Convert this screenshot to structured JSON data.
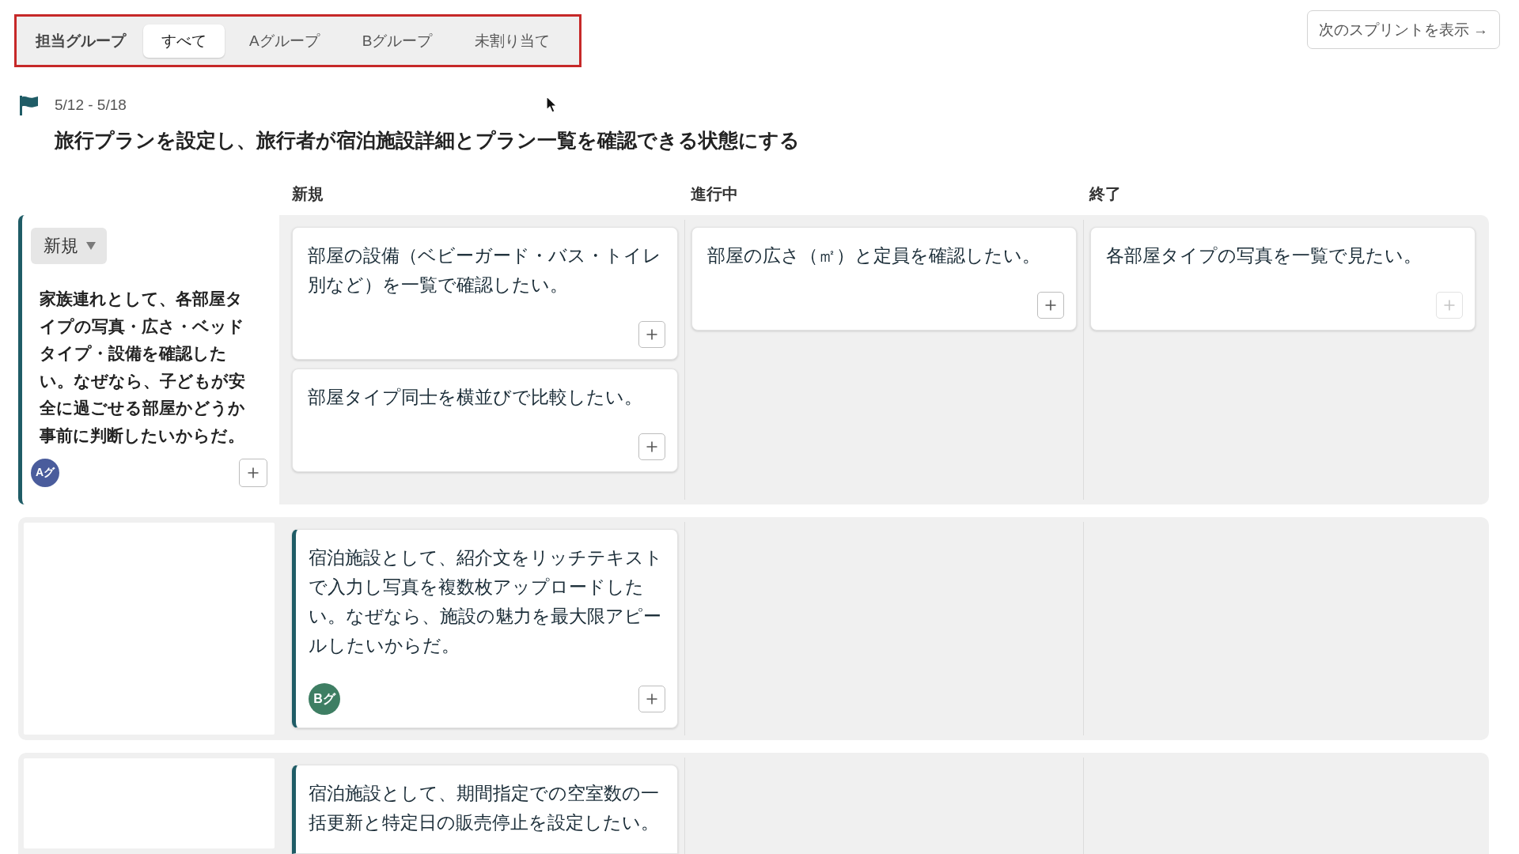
{
  "group_filter": {
    "label": "担当グループ",
    "highlighted": true,
    "tabs": [
      {
        "label": "すべて",
        "selected": true
      },
      {
        "label": "Aグループ",
        "selected": false
      },
      {
        "label": "Bグループ",
        "selected": false
      },
      {
        "label": "未割り当て",
        "selected": false
      }
    ]
  },
  "next_sprint_button": {
    "label": "次のスプリントを表示 →"
  },
  "sprint": {
    "dates": "5/12 - 5/18",
    "goal": "旅行プランを設定し、旅行者が宿泊施設詳細とプラン一覧を確認できる状態にする"
  },
  "board": {
    "columns": [
      "新規",
      "進行中",
      "終了"
    ],
    "rows": [
      {
        "lead": {
          "status": "新規",
          "text": "家族連れとして、各部屋タイプの写真・広さ・ベッドタイプ・設備を確認したい。なぜなら、子どもが安全に過ごせる部屋かどうか事前に判断したいからだ。",
          "group": "Aグ",
          "color": "#4a5c9c",
          "add_button": {
            "disabled": false
          }
        },
        "new": [
          {
            "kind": "task",
            "text": "部屋の設備（ベビーガード・バス・トイレ別など）を一覧で確認したい。",
            "add_button": {
              "disabled": false
            }
          },
          {
            "kind": "task",
            "text": "部屋タイプ同士を横並びで比較したい。",
            "add_button": {
              "disabled": false
            }
          }
        ],
        "in_progress": [
          {
            "kind": "task",
            "text": "部屋の広さ（㎡）と定員を確認したい。",
            "add_button": {
              "disabled": false
            }
          }
        ],
        "done": [
          {
            "kind": "task",
            "text": "各部屋タイプの写真を一覧で見たい。",
            "add_button": {
              "disabled": true
            }
          }
        ]
      },
      {
        "new": [
          {
            "kind": "story",
            "text": "宿泊施設として、紹介文をリッチテキストで入力し写真を複数枚アップロードしたい。なぜなら、施設の魅力を最大限アピールしたいからだ。",
            "group": "Bグ",
            "color": "#3e7e63",
            "add_button": {
              "disabled": false
            }
          }
        ]
      },
      {
        "new": [
          {
            "kind": "story",
            "text": "宿泊施設として、期間指定での空室数の一括更新と特定日の販売停止を設定したい。"
          }
        ]
      }
    ]
  }
}
